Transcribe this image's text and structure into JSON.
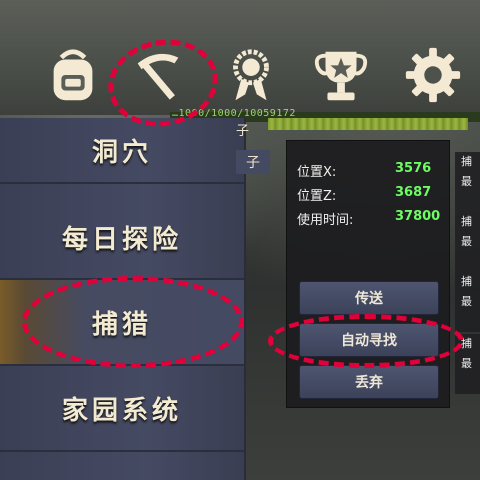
{
  "toolbar": {
    "icons": [
      "backpack-icon",
      "pickaxe-icon",
      "medal-icon",
      "trophy-icon",
      "gear-icon"
    ]
  },
  "status": {
    "text": "…1000/1000/10059172",
    "tag": "子"
  },
  "menu": {
    "items": [
      {
        "label": "洞穴"
      },
      {
        "label": "每日探险"
      },
      {
        "label": "捕猎"
      },
      {
        "label": "家园系统"
      }
    ],
    "side_tab": "子"
  },
  "info": {
    "rows": [
      {
        "label": "位置X:",
        "value": "3576"
      },
      {
        "label": "位置Z:",
        "value": "3687"
      },
      {
        "label": "使用时间:",
        "value": "37800"
      }
    ],
    "buttons": [
      {
        "label": "传送"
      },
      {
        "label": "自动寻找"
      },
      {
        "label": "丢弃"
      }
    ]
  },
  "right_panels": [
    {
      "line1": "捕",
      "line2": "最"
    },
    {
      "line1": "捕",
      "line2": "最"
    },
    {
      "line1": "捕",
      "line2": "最"
    },
    {
      "line1": "捕",
      "line2": "最"
    }
  ],
  "colors": {
    "highlight": "#e0003a",
    "value_green": "#6dfc62",
    "menu_bg": "#454a63",
    "icon_cream": "#f4ead4"
  }
}
